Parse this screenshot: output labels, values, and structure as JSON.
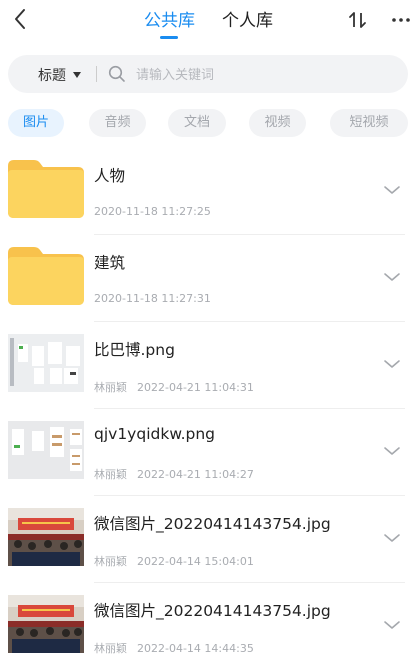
{
  "header": {
    "tabs": [
      {
        "label": "公共库",
        "active": true
      },
      {
        "label": "个人库",
        "active": false
      }
    ],
    "icons": {
      "back": "back-chevron-icon",
      "sort": "sort-icon",
      "more": "more-icon"
    }
  },
  "search": {
    "filter_label": "标题",
    "placeholder": "请输入关键词"
  },
  "categories": [
    {
      "label": "图片",
      "active": true
    },
    {
      "label": "音频",
      "active": false
    },
    {
      "label": "文档",
      "active": false
    },
    {
      "label": "视频",
      "active": false
    },
    {
      "label": "短视频",
      "active": false
    }
  ],
  "items": [
    {
      "type": "folder",
      "name": "人物",
      "owner": "",
      "time": "2020-11-18 11:27:25"
    },
    {
      "type": "folder",
      "name": "建筑",
      "owner": "",
      "time": "2020-11-18 11:27:31"
    },
    {
      "type": "screenshot",
      "name": "比巴博.png",
      "owner": "林丽颖",
      "time": "2022-04-21 11:04:31"
    },
    {
      "type": "screenshot",
      "name": "qjv1yqidkw.png",
      "owner": "林丽颖",
      "time": "2022-04-21 11:04:27"
    },
    {
      "type": "photo",
      "name": "微信图片_20220414143754.jpg",
      "owner": "林丽颖",
      "time": "2022-04-14 15:04:01"
    },
    {
      "type": "photo",
      "name": "微信图片_20220414143754.jpg",
      "owner": "林丽颖",
      "time": "2022-04-14 14:44:35"
    }
  ],
  "colors": {
    "accent": "#1a8cf0",
    "folder": "#fcd45f",
    "folder_tab": "#f8c24c"
  }
}
